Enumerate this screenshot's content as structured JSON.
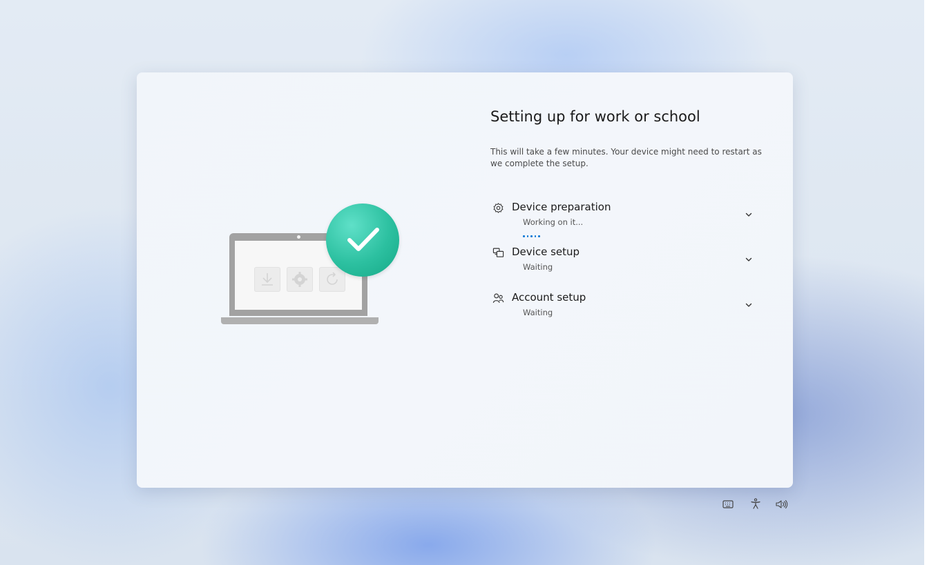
{
  "card": {
    "title": "Setting up for work or school",
    "description": "This will take a few minutes. Your device might need to restart as we complete the setup."
  },
  "illustration": {
    "tiles": [
      "download-icon",
      "gear-icon",
      "refresh-icon"
    ],
    "badge": "checkmark-icon"
  },
  "steps": [
    {
      "icon": "gear-icon",
      "label": "Device preparation",
      "status": "Working on it...",
      "progress_dots": 5
    },
    {
      "icon": "devices-icon",
      "label": "Device setup",
      "status": "Waiting"
    },
    {
      "icon": "people-icon",
      "label": "Account setup",
      "status": "Waiting"
    }
  ],
  "tray": [
    "keyboard-icon",
    "accessibility-icon",
    "volume-icon"
  ],
  "colors": {
    "accent": "#0a78d4",
    "check": "#2cc0a0",
    "background": "#dfe8f1"
  }
}
